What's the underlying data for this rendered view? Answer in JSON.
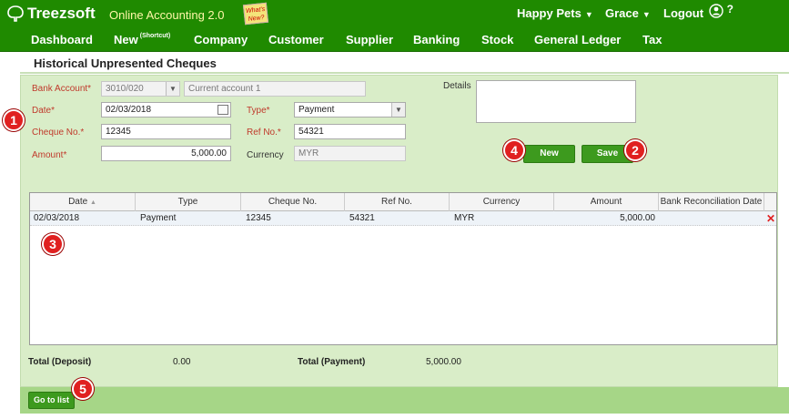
{
  "brand": {
    "name": "Treezsoft",
    "product": "Online Accounting 2.0",
    "whats_new": "What's New?"
  },
  "top_right": {
    "company": "Happy Pets",
    "user": "Grace",
    "logout": "Logout",
    "help": "?"
  },
  "nav": {
    "items": [
      {
        "label": "Dashboard",
        "sup": ""
      },
      {
        "label": "New",
        "sup": "(Shortcut)"
      },
      {
        "label": "Company",
        "sup": ""
      },
      {
        "label": "Customer",
        "sup": ""
      },
      {
        "label": "Supplier",
        "sup": ""
      },
      {
        "label": "Banking",
        "sup": ""
      },
      {
        "label": "Stock",
        "sup": ""
      },
      {
        "label": "General Ledger",
        "sup": ""
      },
      {
        "label": "Tax",
        "sup": ""
      }
    ]
  },
  "page": {
    "title": "Historical Unpresented Cheques"
  },
  "form": {
    "bank_account": {
      "label": "Bank Account*",
      "code": "3010/020",
      "name": "Current account 1"
    },
    "date": {
      "label": "Date*",
      "value": "02/03/2018"
    },
    "cheque_no": {
      "label": "Cheque No.*",
      "value": "12345"
    },
    "amount": {
      "label": "Amount*",
      "value": "5,000.00"
    },
    "type": {
      "label": "Type*",
      "value": "Payment"
    },
    "ref_no": {
      "label": "Ref No.*",
      "value": "54321"
    },
    "currency": {
      "label": "Currency",
      "value": "MYR"
    },
    "details": {
      "label": "Details",
      "value": ""
    }
  },
  "buttons": {
    "new": "New",
    "save": "Save",
    "go_to_list": "Go to list"
  },
  "grid": {
    "columns": [
      "Date",
      "Type",
      "Cheque No.",
      "Ref No.",
      "Currency",
      "Amount",
      "Bank Reconciliation Date"
    ],
    "sort_indicator": "▲",
    "rows": [
      {
        "date": "02/03/2018",
        "type": "Payment",
        "cheque_no": "12345",
        "ref_no": "54321",
        "currency": "MYR",
        "amount": "5,000.00",
        "recon_date": ""
      }
    ],
    "delete_icon": "✕"
  },
  "totals": {
    "deposit_label": "Total (Deposit)",
    "deposit_value": "0.00",
    "payment_label": "Total (Payment)",
    "payment_value": "5,000.00"
  },
  "badges": [
    "1",
    "2",
    "3",
    "4",
    "5"
  ],
  "colors": {
    "nav_bg": "#1f8a00",
    "panel_bg": "#d9edc8",
    "button_green": "#3d9a1e",
    "required_label": "#c0392b",
    "badge_red": "#e02020"
  }
}
